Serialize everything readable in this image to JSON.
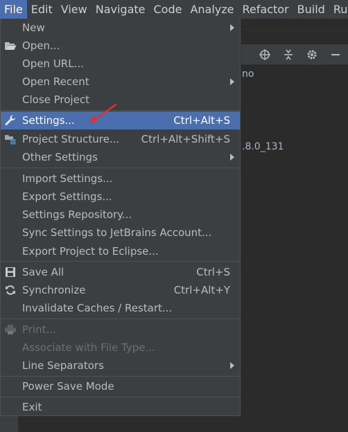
{
  "menubar": {
    "items": [
      {
        "label": "File"
      },
      {
        "label": "Edit"
      },
      {
        "label": "View"
      },
      {
        "label": "Navigate"
      },
      {
        "label": "Code"
      },
      {
        "label": "Analyze"
      },
      {
        "label": "Refactor"
      },
      {
        "label": "Build"
      },
      {
        "label": "Ru"
      }
    ]
  },
  "background": {
    "text_top": "no",
    "text_jdk": ".8.0_131"
  },
  "file_menu": {
    "new": "New",
    "open": "Open...",
    "open_url": "Open URL...",
    "open_recent": "Open Recent",
    "close_project": "Close Project",
    "settings": "Settings...",
    "settings_shortcut": "Ctrl+Alt+S",
    "project_structure": "Project Structure...",
    "project_structure_shortcut": "Ctrl+Alt+Shift+S",
    "other_settings": "Other Settings",
    "import_settings": "Import Settings...",
    "export_settings": "Export Settings...",
    "settings_repository": "Settings Repository...",
    "sync_settings": "Sync Settings to JetBrains Account...",
    "export_eclipse": "Export Project to Eclipse...",
    "save_all": "Save All",
    "save_all_shortcut": "Ctrl+S",
    "synchronize": "Synchronize",
    "synchronize_shortcut": "Ctrl+Alt+Y",
    "invalidate_caches": "Invalidate Caches / Restart...",
    "print": "Print...",
    "associate": "Associate with File Type...",
    "line_separators": "Line Separators",
    "power_save": "Power Save Mode",
    "exit": "Exit"
  },
  "colors": {
    "highlight": "#4b6eaf",
    "menu_bg": "#3c3f41",
    "annotation_arrow": "#e03030"
  }
}
